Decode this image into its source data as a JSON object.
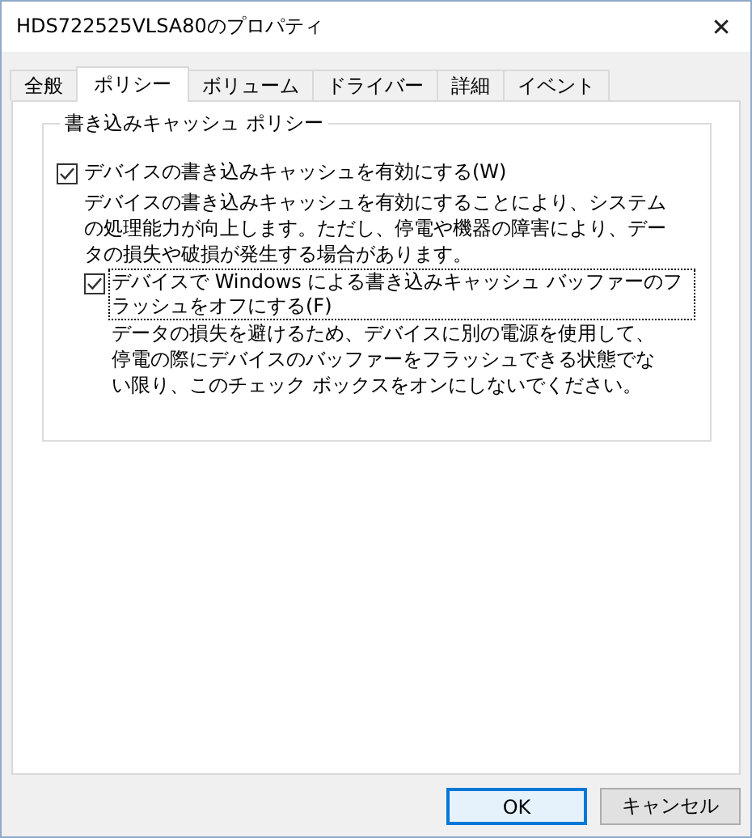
{
  "window": {
    "title": "HDS722525VLSA80のプロパティ",
    "close": "✕"
  },
  "tabs": [
    {
      "label": "全般",
      "selected": false
    },
    {
      "label": "ポリシー",
      "selected": true
    },
    {
      "label": "ボリューム",
      "selected": false
    },
    {
      "label": "ドライバー",
      "selected": false
    },
    {
      "label": "詳細",
      "selected": false
    },
    {
      "label": "イベント",
      "selected": false
    }
  ],
  "group": {
    "title": "書き込みキャッシュ ポリシー",
    "options": [
      {
        "label": "デバイスの書き込みキャッシュを有効にする(W)",
        "checked": true,
        "focused": false,
        "description": "デバイスの書き込みキャッシュを有効にすることにより、システムの処理能力が向上します。ただし、停電や機器の障害により、データの損失や破損が発生する場合があります。",
        "children": [
          {
            "label": "デバイスで Windows による書き込みキャッシュ バッファーのフラッシュをオフにする(F)",
            "checked": true,
            "focused": true,
            "description": "データの損失を避けるため、デバイスに別の電源を使用して、停電の際にデバイスのバッファーをフラッシュできる状態でない限り、このチェック ボックスをオンにしないでください。"
          }
        ]
      }
    ]
  },
  "buttons": [
    {
      "label": "OK",
      "default": true
    },
    {
      "label": "キャンセル",
      "default": false
    }
  ]
}
